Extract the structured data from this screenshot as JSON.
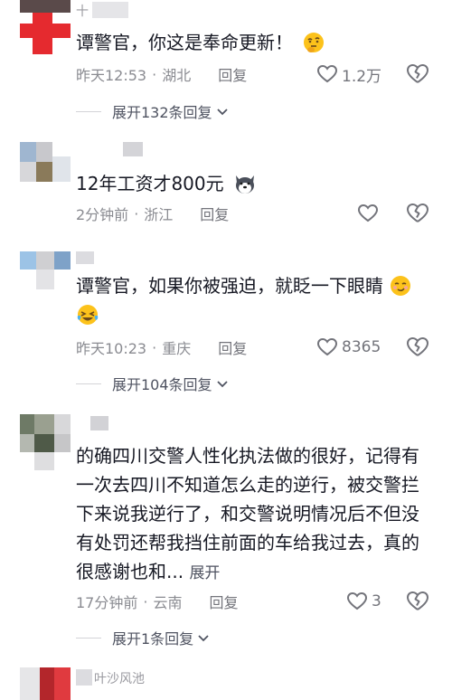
{
  "comments": [
    {
      "name": "十",
      "text": "谭警官，你这是奉命更新！",
      "emoji": "thinking-face-emoji",
      "time": "昨天12:53",
      "location": "湖北",
      "reply_label": "回复",
      "likes": "1.2万",
      "expand_label": "展开132条回复"
    },
    {
      "name": "",
      "text": "12年工资才800元",
      "emoji": "husky-dog-emoji",
      "time": "2分钟前",
      "location": "浙江",
      "reply_label": "回复",
      "likes": "",
      "expand_label": ""
    },
    {
      "name": "",
      "text": "谭警官，如果你被强迫，就眨一下眼睛",
      "emoji": "smirk-face-emoji",
      "emoji2": "laughing-tears-emoji",
      "time": "昨天10:23",
      "location": "重庆",
      "reply_label": "回复",
      "likes": "8365",
      "expand_label": "展开104条回复"
    },
    {
      "name": "",
      "text": "的确四川交警人性化执法做的很好，记得有一次去四川不知道怎么走的逆行，被交警拦下来说我逆行了，和交警说明情况后不但没有处罚还帮我挡住前面的车给我过去，真的很感谢也和...",
      "expand_inline": "展开",
      "time": "17分钟前",
      "location": "云南",
      "reply_label": "回复",
      "likes": "3",
      "expand_label": "展开1条回复"
    },
    {
      "name": "叶沙风池"
    }
  ],
  "separator": "·",
  "colors": {
    "text": "#161823",
    "meta": "#8a8b91",
    "icon": "#73747b"
  }
}
